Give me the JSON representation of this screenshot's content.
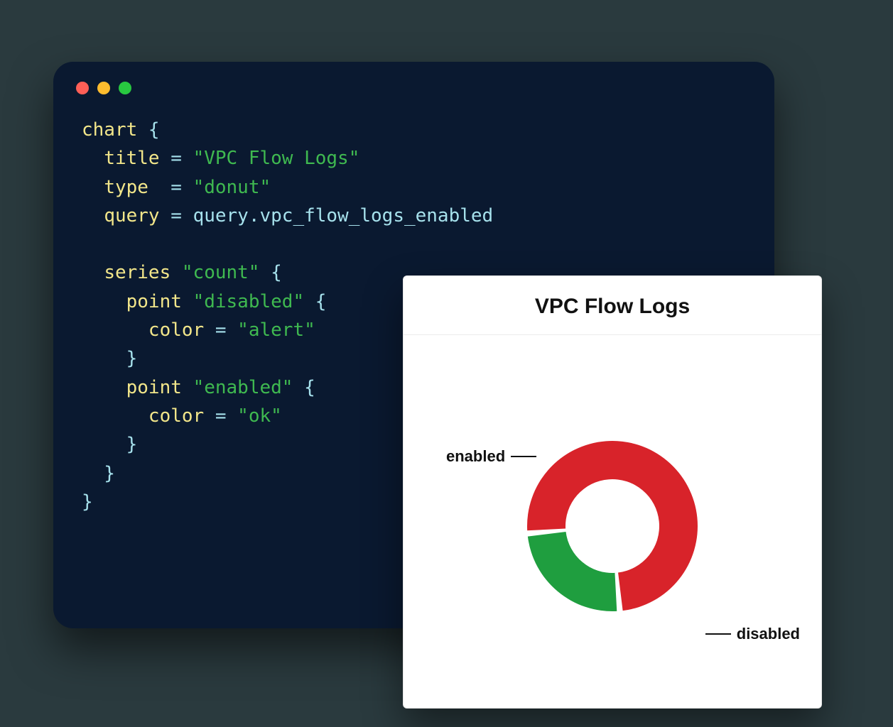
{
  "code": {
    "tokens": [
      {
        "t": "kw",
        "v": "chart"
      },
      {
        "t": "op",
        "v": " {\n"
      },
      {
        "t": "op",
        "v": "  "
      },
      {
        "t": "kw",
        "v": "title"
      },
      {
        "t": "op",
        "v": " = "
      },
      {
        "t": "str",
        "v": "\"VPC Flow Logs\""
      },
      {
        "t": "op",
        "v": "\n"
      },
      {
        "t": "op",
        "v": "  "
      },
      {
        "t": "kw",
        "v": "type"
      },
      {
        "t": "op",
        "v": "  = "
      },
      {
        "t": "str",
        "v": "\"donut\""
      },
      {
        "t": "op",
        "v": "\n"
      },
      {
        "t": "op",
        "v": "  "
      },
      {
        "t": "kw",
        "v": "query"
      },
      {
        "t": "op",
        "v": " = "
      },
      {
        "t": "ref",
        "v": "query.vpc_flow_logs_enabled"
      },
      {
        "t": "op",
        "v": "\n\n"
      },
      {
        "t": "op",
        "v": "  "
      },
      {
        "t": "kw",
        "v": "series"
      },
      {
        "t": "op",
        "v": " "
      },
      {
        "t": "str",
        "v": "\"count\""
      },
      {
        "t": "op",
        "v": " {\n"
      },
      {
        "t": "op",
        "v": "    "
      },
      {
        "t": "kw",
        "v": "point"
      },
      {
        "t": "op",
        "v": " "
      },
      {
        "t": "str",
        "v": "\"disabled\""
      },
      {
        "t": "op",
        "v": " {\n"
      },
      {
        "t": "op",
        "v": "      "
      },
      {
        "t": "kw",
        "v": "color"
      },
      {
        "t": "op",
        "v": " = "
      },
      {
        "t": "str",
        "v": "\"alert\""
      },
      {
        "t": "op",
        "v": "\n"
      },
      {
        "t": "op",
        "v": "    }\n"
      },
      {
        "t": "op",
        "v": "    "
      },
      {
        "t": "kw",
        "v": "point"
      },
      {
        "t": "op",
        "v": " "
      },
      {
        "t": "str",
        "v": "\"enabled\""
      },
      {
        "t": "op",
        "v": " {\n"
      },
      {
        "t": "op",
        "v": "      "
      },
      {
        "t": "kw",
        "v": "color"
      },
      {
        "t": "op",
        "v": " = "
      },
      {
        "t": "str",
        "v": "\"ok\""
      },
      {
        "t": "op",
        "v": "\n"
      },
      {
        "t": "op",
        "v": "    }\n"
      },
      {
        "t": "op",
        "v": "  }\n"
      },
      {
        "t": "op",
        "v": "}"
      }
    ]
  },
  "chart": {
    "title": "VPC Flow Logs",
    "labels": {
      "enabled": "enabled",
      "disabled": "disabled"
    }
  },
  "chart_data": {
    "type": "donut",
    "title": "VPC Flow Logs",
    "series": [
      {
        "name": "count",
        "points": [
          {
            "label": "enabled",
            "value": 25,
            "color": "#1f9e3f"
          },
          {
            "label": "disabled",
            "value": 75,
            "color": "#d8232a"
          }
        ]
      }
    ]
  },
  "colors": {
    "ok": "#1f9e3f",
    "alert": "#d8232a"
  }
}
